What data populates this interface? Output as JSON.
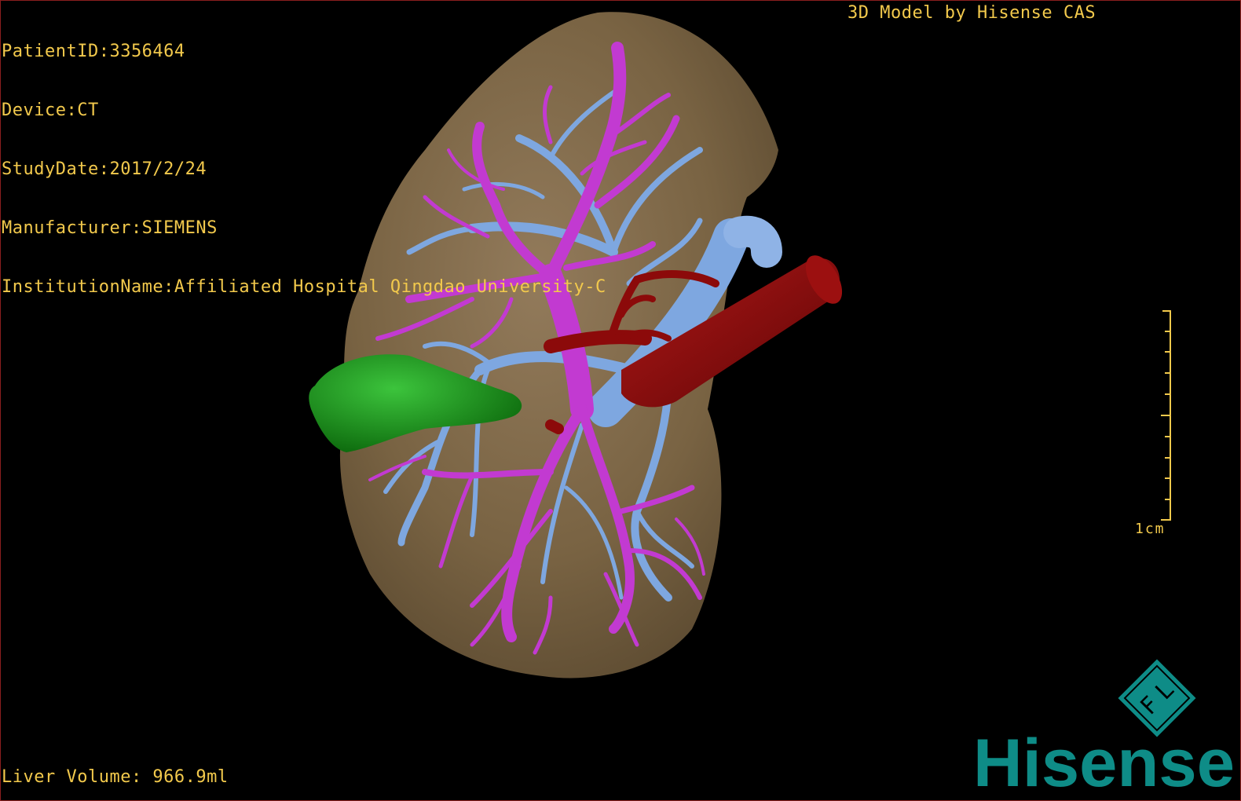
{
  "overlay": {
    "patient_id": "PatientID:3356464",
    "device": "Device:CT",
    "study_date": "StudyDate:2017/2/24",
    "manufacturer": "Manufacturer:SIEMENS",
    "institution": "InstitutionName:Affiliated Hospital Qingdao University-C",
    "model_credit": "3D Model by Hisense CAS",
    "liver_volume": "Liver Volume: 966.9ml"
  },
  "scale_bar": {
    "label": "1cm"
  },
  "logo": {
    "mark_letters": "F L",
    "brand": "Hisense"
  },
  "colors": {
    "overlay_text": "#f2c94c",
    "liver": "#8a7352",
    "hepatic_vein": "#c23ad1",
    "portal_vein": "#7ea7e0",
    "artery_ivc": "#8c0a0a",
    "gallbladder": "#1f9a1f",
    "brand_teal": "#0e8c87"
  }
}
